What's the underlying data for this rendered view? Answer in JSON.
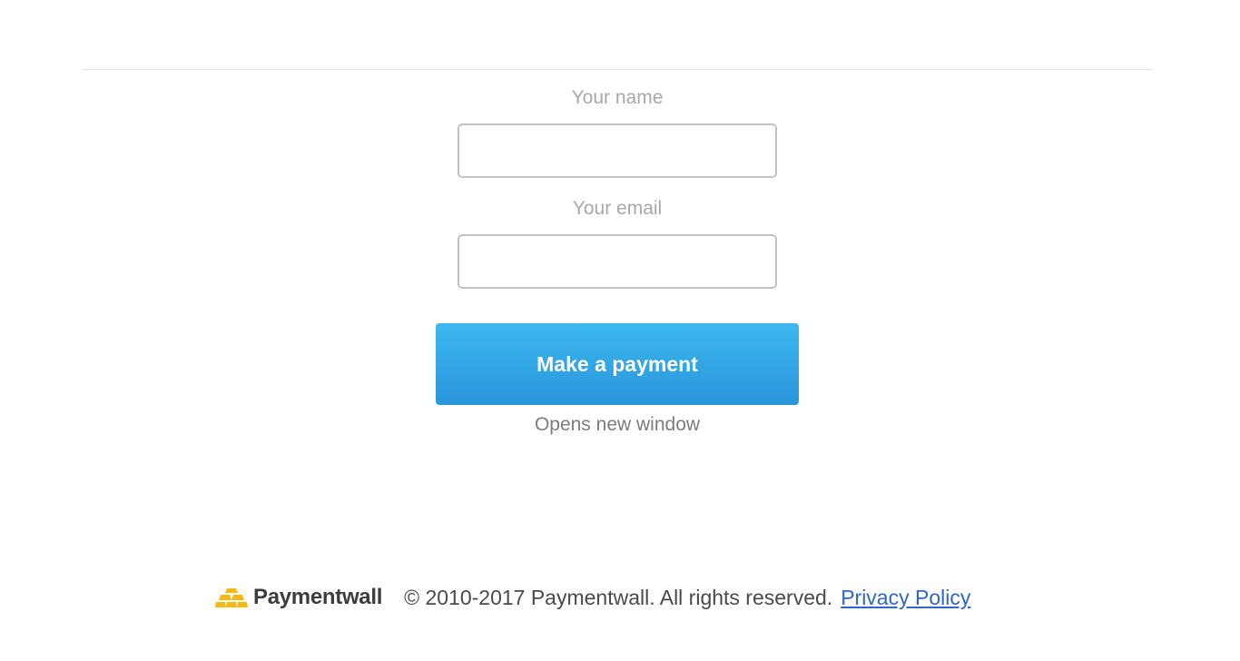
{
  "form": {
    "name_label": "Your name",
    "name_value": "",
    "email_label": "Your email",
    "email_value": "",
    "submit_label": "Make a payment",
    "hint": "Opens new window"
  },
  "footer": {
    "logo_text": "Paymentwall",
    "logo_icon": "gold-bars-icon",
    "copyright": "© 2010-2017 Paymentwall. All rights reserved.",
    "privacy_link": "Privacy Policy"
  },
  "colors": {
    "button_top": "#3cb8ef",
    "button_bottom": "#2a95dc",
    "link": "#2f66c7",
    "logo_gold": "#f5b914"
  }
}
